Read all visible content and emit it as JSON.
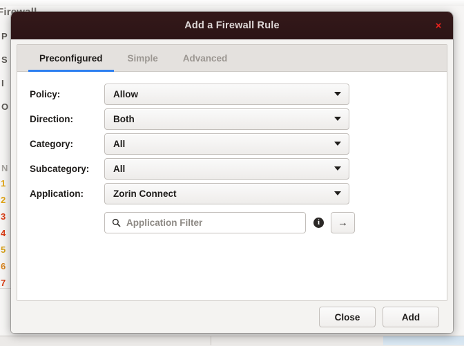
{
  "background": {
    "app_heading": "Firewall",
    "side_labels": [
      "P",
      "S",
      "I",
      "O"
    ],
    "list_column_header": "N",
    "rows": [
      {
        "num": "1",
        "color": "#e0a313"
      },
      {
        "num": "2",
        "color": "#e0a313"
      },
      {
        "num": "3",
        "color": "#d93b14"
      },
      {
        "num": "4",
        "color": "#d93b14"
      },
      {
        "num": "5",
        "color": "#d6a018"
      },
      {
        "num": "6",
        "color": "#d6801a"
      },
      {
        "num": "7",
        "color": "#d93b14"
      }
    ]
  },
  "dialog": {
    "title": "Add a Firewall Rule",
    "close_icon": "×",
    "tabs": [
      {
        "label": "Preconfigured",
        "active": true
      },
      {
        "label": "Simple",
        "active": false
      },
      {
        "label": "Advanced",
        "active": false
      }
    ],
    "fields": [
      {
        "label": "Policy:",
        "value": "Allow"
      },
      {
        "label": "Direction:",
        "value": "Both"
      },
      {
        "label": "Category:",
        "value": "All"
      },
      {
        "label": "Subcategory:",
        "value": "All"
      },
      {
        "label": "Application:",
        "value": "Zorin Connect"
      }
    ],
    "filter": {
      "placeholder": "Application Filter",
      "value": "",
      "info_glyph": "i",
      "submit_glyph": "→"
    },
    "buttons": {
      "close": "Close",
      "add": "Add"
    },
    "accent_color": "#2d7ff0",
    "titlebar_color": "#2c1415",
    "close_color": "#e8221c"
  }
}
